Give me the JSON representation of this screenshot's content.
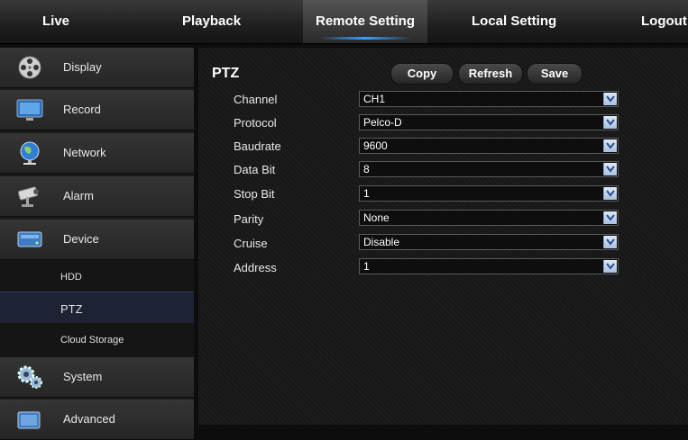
{
  "nav": {
    "tabs": [
      "Live",
      "Playback",
      "Remote Setting",
      "Local Setting",
      "Logout"
    ],
    "active_index": 2
  },
  "sidebar": {
    "menu": [
      {
        "label": "Display",
        "icon": "film-reel-icon"
      },
      {
        "label": "Record",
        "icon": "monitor-icon"
      },
      {
        "label": "Network",
        "icon": "globe-icon"
      },
      {
        "label": "Alarm",
        "icon": "cctv-camera-icon"
      },
      {
        "label": "Device",
        "icon": "hard-drive-icon"
      }
    ],
    "submenu": [
      "HDD",
      "PTZ",
      "Cloud Storage"
    ],
    "active_submenu": "PTZ",
    "menu_after": [
      {
        "label": "System",
        "icon": "gears-icon"
      },
      {
        "label": "Advanced",
        "icon": "advanced-icon"
      }
    ]
  },
  "content": {
    "title": "PTZ",
    "buttons": {
      "copy": "Copy",
      "refresh": "Refresh",
      "save": "Save"
    },
    "fields": [
      {
        "label": "Channel",
        "value": "CH1"
      },
      {
        "label": "Protocol",
        "value": "Pelco-D"
      },
      {
        "label": "Baudrate",
        "value": "9600"
      },
      {
        "label": "Data Bit",
        "value": "8"
      },
      {
        "label": "Stop Bit",
        "value": "1"
      },
      {
        "label": "Parity",
        "value": "None"
      },
      {
        "label": "Cruise",
        "value": "Disable"
      },
      {
        "label": "Address",
        "value": "1"
      }
    ]
  },
  "colors": {
    "accent": "#3aa0ff",
    "active_submenu_bg": "#1d2333",
    "dropdown_arrow_bg": "#c8d8ef"
  }
}
